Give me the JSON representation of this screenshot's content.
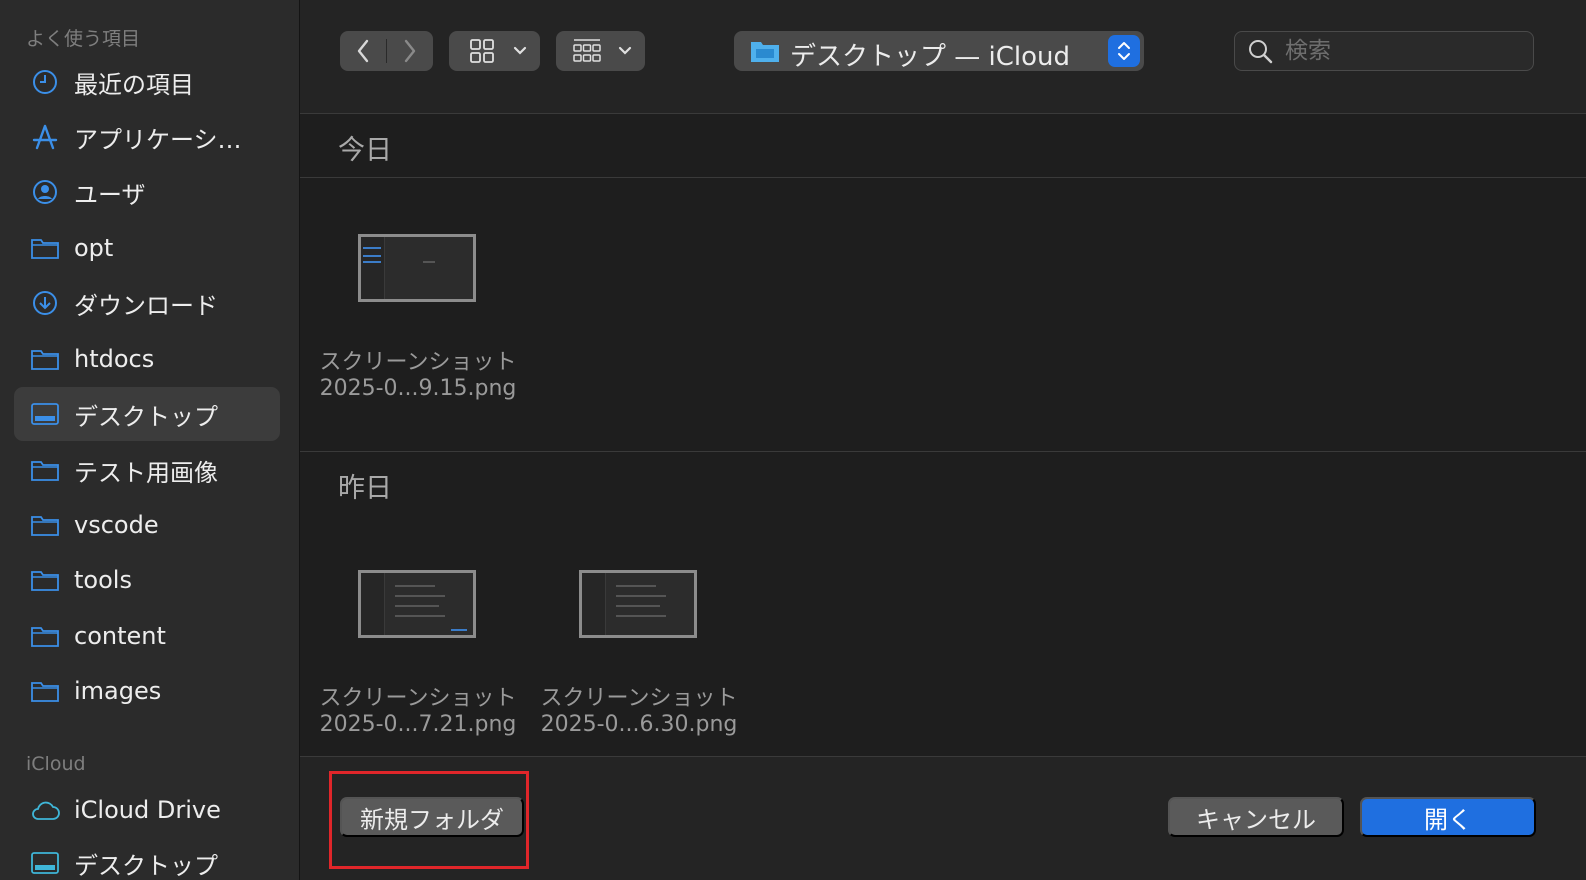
{
  "sidebar": {
    "favorites_title": "よく使う項目",
    "items": [
      {
        "label": "最近の項目",
        "icon": "clock-icon"
      },
      {
        "label": "アプリケーシ…",
        "icon": "applications-icon"
      },
      {
        "label": "ユーザ",
        "icon": "user-circle-icon"
      },
      {
        "label": "opt",
        "icon": "folder-icon"
      },
      {
        "label": "ダウンロード",
        "icon": "download-icon"
      },
      {
        "label": "htdocs",
        "icon": "folder-icon"
      },
      {
        "label": "デスクトップ",
        "icon": "desktop-icon",
        "selected": true
      },
      {
        "label": "テスト用画像",
        "icon": "folder-icon"
      },
      {
        "label": "vscode",
        "icon": "folder-icon"
      },
      {
        "label": "tools",
        "icon": "folder-icon"
      },
      {
        "label": "content",
        "icon": "folder-icon"
      },
      {
        "label": "images",
        "icon": "folder-icon"
      }
    ],
    "icloud_title": "iCloud",
    "icloud_items": [
      {
        "label": "iCloud Drive",
        "icon": "cloud-icon"
      },
      {
        "label": "デスクトップ",
        "icon": "desktop-icon"
      }
    ]
  },
  "toolbar": {
    "path_label": "デスクトップ — iCloud",
    "search_placeholder": "検索"
  },
  "groups": [
    {
      "title": "今日",
      "files": [
        {
          "name_line1": "スクリーンショット",
          "name_line2": "2025-0...9.15.png"
        }
      ]
    },
    {
      "title": "昨日",
      "files": [
        {
          "name_line1": "スクリーンショット",
          "name_line2": "2025-0...7.21.png"
        },
        {
          "name_line1": "スクリーンショット",
          "name_line2": "2025-0...6.30.png"
        }
      ]
    }
  ],
  "footer": {
    "new_folder_label": "新規フォルダ",
    "cancel_label": "キャンセル",
    "open_label": "開く"
  },
  "colors": {
    "accent": "#1f6fe0",
    "icon_blue": "#3b8fe8",
    "highlight": "#e0262a"
  }
}
